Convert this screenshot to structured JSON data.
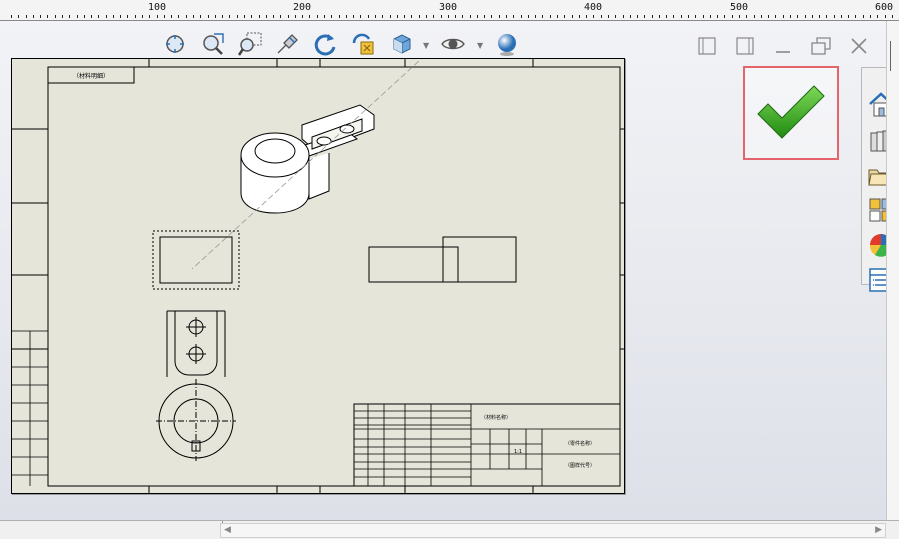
{
  "ruler": {
    "labels": [
      "100",
      "200",
      "300",
      "400",
      "500",
      "600"
    ]
  },
  "toolbar": {
    "icons": [
      "zoom-to-fit-icon",
      "zoom-to-area-icon",
      "zoom-in-out-icon",
      "select-icon",
      "rotate-icon",
      "zoom-previous-icon",
      "display-style-icon",
      "hide-show-icon",
      "appearance-icon"
    ]
  },
  "window_controls": {
    "icons": [
      "tile-left-icon",
      "tile-right-icon",
      "minimize-icon",
      "restore-icon",
      "close-icon"
    ]
  },
  "confirm": {
    "icon": "checkmark-icon",
    "accent": "#2e9a1e",
    "border": "#e5636a"
  },
  "task_pane": {
    "icons": [
      "home-icon",
      "design-library-icon",
      "file-explorer-icon",
      "view-palette-icon",
      "appearances-icon",
      "custom-properties-icon"
    ]
  },
  "sheet": {
    "title_label": "（材料明细）",
    "title_block": {
      "material": "（材料名称）",
      "part_name": "（零件名称）",
      "drawing_no": "（图样代号）",
      "scale": "1:1"
    }
  }
}
